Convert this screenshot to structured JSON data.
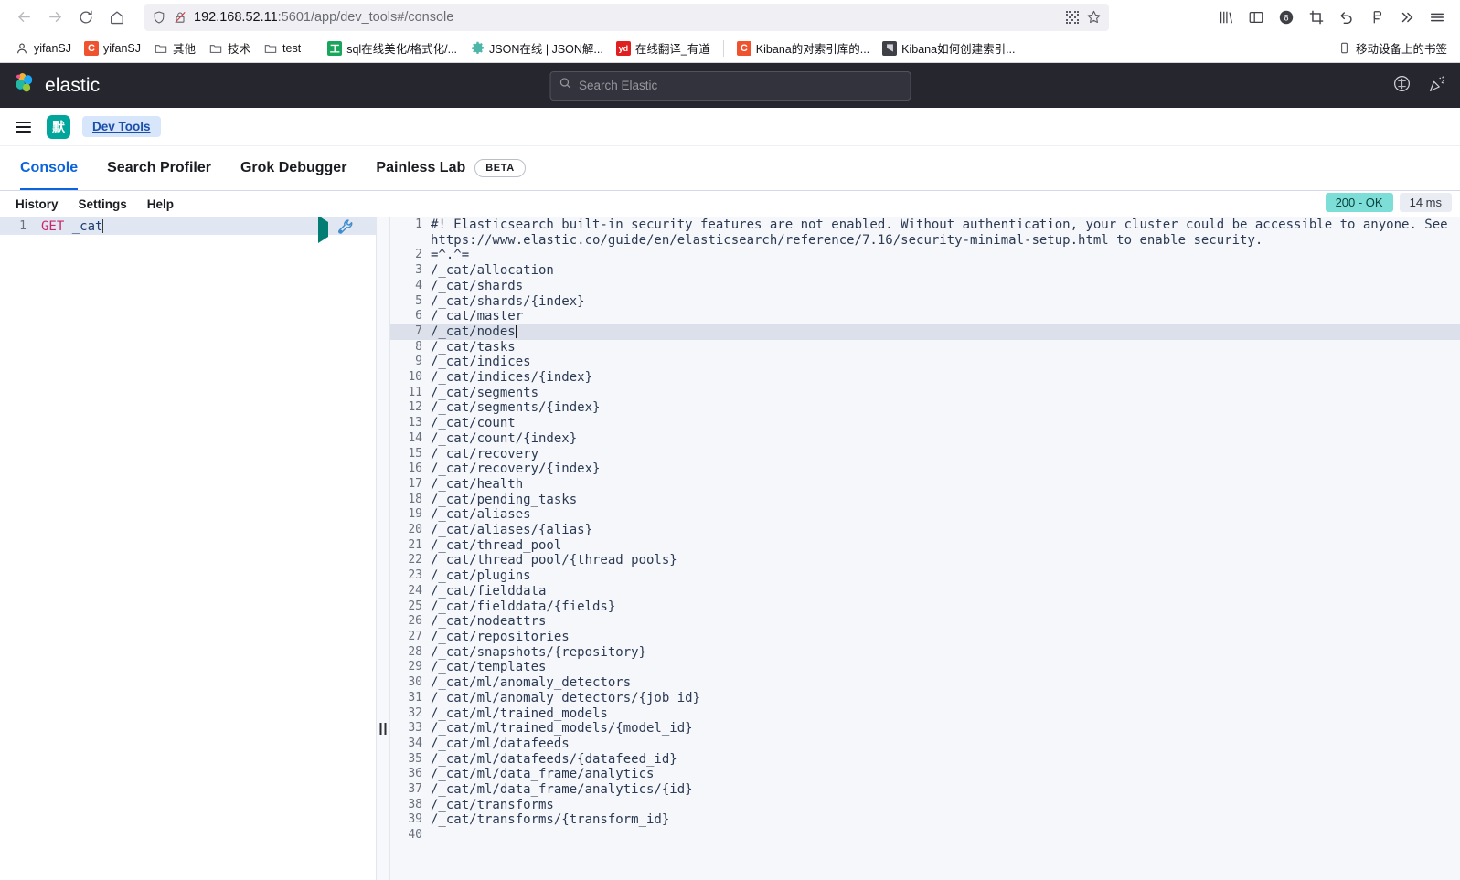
{
  "browser": {
    "nav": {
      "back": "back-arrow",
      "forward": "forward-arrow",
      "reload": "reload",
      "home": "home"
    },
    "url_host": "192.168.52.11",
    "url_path": ":5601/app/dev_tools#/console",
    "toolbar_icons": [
      "library-icon",
      "sidebar-icon",
      "container-8-icon",
      "crop-icon",
      "undo-icon",
      "pocket-icon",
      "overflow-chevrons-icon",
      "app-menu-icon"
    ],
    "urlbar_icons": [
      "shield-icon",
      "broken-lock-icon",
      "qr-icon",
      "star-icon"
    ]
  },
  "bookmarks": {
    "items": [
      {
        "label": "yifanSJ",
        "icon": "person-icon"
      },
      {
        "label": "yifanSJ",
        "icon": "c-icon"
      },
      {
        "label": "其他",
        "icon": "folder-icon"
      },
      {
        "label": "技术",
        "icon": "folder-icon"
      },
      {
        "label": "test",
        "icon": "folder-icon"
      },
      {
        "label": "sql在线美化/格式化/...",
        "icon": "sql-icon"
      },
      {
        "label": "JSON在线 | JSON解...",
        "icon": "gear-icon"
      },
      {
        "label": "在线翻译_有道",
        "icon": "yd-icon"
      },
      {
        "label": "Kibana的对索引库的...",
        "icon": "c-icon"
      },
      {
        "label": "Kibana如何创建索引...",
        "icon": "kibana-icon"
      }
    ],
    "mobile_label": "移动设备上的书签",
    "mobile_icon": "mobile-icon"
  },
  "elastic_header": {
    "brand": "elastic",
    "search_placeholder": "Search Elastic",
    "icons": [
      "help-icon",
      "news-icon"
    ]
  },
  "kibana_nav": {
    "menu_icon": "hamburger-menu-icon",
    "space_badge": "默",
    "breadcrumb": "Dev Tools"
  },
  "dev_tools": {
    "tabs": [
      {
        "label": "Console",
        "active": true
      },
      {
        "label": "Search Profiler",
        "active": false
      },
      {
        "label": "Grok Debugger",
        "active": false
      },
      {
        "label": "Painless Lab",
        "active": false,
        "badge": "BETA"
      }
    ]
  },
  "console": {
    "menu": [
      "History",
      "Settings",
      "Help"
    ],
    "status": "200 - OK",
    "time": "14 ms",
    "actions": {
      "play": "play-icon",
      "wrench": "wrench-icon"
    },
    "request": {
      "line_number": "1",
      "method": "GET",
      "path": " _cat"
    },
    "response_lines": [
      {
        "n": "1",
        "text": "#! Elasticsearch built-in security features are not enabled. Without authentication, your cluster could be accessible to anyone. See https://www.elastic.co/guide/en/elasticsearch/reference/7.16/security-minimal-setup.html to enable security."
      },
      {
        "n": "2",
        "text": "=^.^="
      },
      {
        "n": "3",
        "text": "/_cat/allocation"
      },
      {
        "n": "4",
        "text": "/_cat/shards"
      },
      {
        "n": "5",
        "text": "/_cat/shards/{index}"
      },
      {
        "n": "6",
        "text": "/_cat/master"
      },
      {
        "n": "7",
        "text": "/_cat/nodes",
        "current": true
      },
      {
        "n": "8",
        "text": "/_cat/tasks"
      },
      {
        "n": "9",
        "text": "/_cat/indices"
      },
      {
        "n": "10",
        "text": "/_cat/indices/{index}"
      },
      {
        "n": "11",
        "text": "/_cat/segments"
      },
      {
        "n": "12",
        "text": "/_cat/segments/{index}"
      },
      {
        "n": "13",
        "text": "/_cat/count"
      },
      {
        "n": "14",
        "text": "/_cat/count/{index}"
      },
      {
        "n": "15",
        "text": "/_cat/recovery"
      },
      {
        "n": "16",
        "text": "/_cat/recovery/{index}"
      },
      {
        "n": "17",
        "text": "/_cat/health"
      },
      {
        "n": "18",
        "text": "/_cat/pending_tasks"
      },
      {
        "n": "19",
        "text": "/_cat/aliases"
      },
      {
        "n": "20",
        "text": "/_cat/aliases/{alias}"
      },
      {
        "n": "21",
        "text": "/_cat/thread_pool"
      },
      {
        "n": "22",
        "text": "/_cat/thread_pool/{thread_pools}"
      },
      {
        "n": "23",
        "text": "/_cat/plugins"
      },
      {
        "n": "24",
        "text": "/_cat/fielddata"
      },
      {
        "n": "25",
        "text": "/_cat/fielddata/{fields}"
      },
      {
        "n": "26",
        "text": "/_cat/nodeattrs"
      },
      {
        "n": "27",
        "text": "/_cat/repositories"
      },
      {
        "n": "28",
        "text": "/_cat/snapshots/{repository}"
      },
      {
        "n": "29",
        "text": "/_cat/templates"
      },
      {
        "n": "30",
        "text": "/_cat/ml/anomaly_detectors"
      },
      {
        "n": "31",
        "text": "/_cat/ml/anomaly_detectors/{job_id}"
      },
      {
        "n": "32",
        "text": "/_cat/ml/trained_models"
      },
      {
        "n": "33",
        "text": "/_cat/ml/trained_models/{model_id}"
      },
      {
        "n": "34",
        "text": "/_cat/ml/datafeeds"
      },
      {
        "n": "35",
        "text": "/_cat/ml/datafeeds/{datafeed_id}"
      },
      {
        "n": "36",
        "text": "/_cat/ml/data_frame/analytics"
      },
      {
        "n": "37",
        "text": "/_cat/ml/data_frame/analytics/{id}"
      },
      {
        "n": "38",
        "text": "/_cat/transforms"
      },
      {
        "n": "39",
        "text": "/_cat/transforms/{transform_id}"
      },
      {
        "n": "40",
        "text": ""
      }
    ]
  },
  "colors": {
    "accent": "#0b64dd",
    "status_ok": "#7dded8",
    "space_badge": "#00a69b",
    "header_bg": "#25262e"
  }
}
